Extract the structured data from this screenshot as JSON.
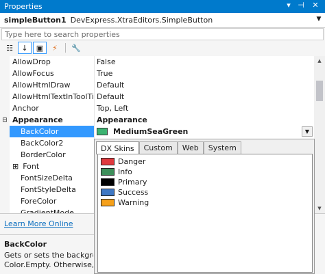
{
  "window": {
    "title": "Properties",
    "controls": [
      "▾",
      "⊣",
      "✕"
    ]
  },
  "object_selector": {
    "name": "simpleButton1",
    "type": "DevExpress.XtraEditors.SimpleButton"
  },
  "search": {
    "placeholder": "Type here to search properties"
  },
  "toolbar": {
    "buttons": [
      {
        "icon": "categorized-icon",
        "glyph": "☷",
        "active": false
      },
      {
        "icon": "alphabetical-icon",
        "glyph": "↓",
        "active": true
      },
      {
        "icon": "properties-icon",
        "glyph": "▣",
        "active": true
      },
      {
        "icon": "events-icon",
        "glyph": "⚡",
        "active": false
      },
      {
        "icon": "wrench-icon",
        "glyph": "🔧",
        "active": false
      }
    ]
  },
  "properties": [
    {
      "name": "AllowDrop",
      "value": "False"
    },
    {
      "name": "AllowFocus",
      "value": "True"
    },
    {
      "name": "AllowHtmlDraw",
      "value": "Default"
    },
    {
      "name": "AllowHtmlTextInToolTip",
      "value": "Default"
    },
    {
      "name": "Anchor",
      "value": "Top, Left"
    },
    {
      "name": "Appearance",
      "value": "Appearance",
      "expander": "⊟",
      "category": true
    },
    {
      "name": "BackColor",
      "value": "MediumSeaGreen",
      "indent": true,
      "selected": true
    },
    {
      "name": "BackColor2",
      "value": "",
      "indent": true
    },
    {
      "name": "BorderColor",
      "value": "",
      "indent": true
    },
    {
      "name": "Font",
      "value": "",
      "indent": true,
      "expander": "⊞"
    },
    {
      "name": "FontSizeDelta",
      "value": "",
      "indent": true
    },
    {
      "name": "FontStyleDelta",
      "value": "",
      "indent": true
    },
    {
      "name": "ForeColor",
      "value": "",
      "indent": true
    },
    {
      "name": "GradientMode",
      "value": "",
      "indent": true
    }
  ],
  "color_popup": {
    "tabs": [
      "DX Skins",
      "Custom",
      "Web",
      "System"
    ],
    "active_tab": 0,
    "colors": [
      {
        "label": "Danger",
        "color": "#e0393e"
      },
      {
        "label": "Info",
        "color": "#3d8f5a"
      },
      {
        "label": "Primary",
        "color": "#000000"
      },
      {
        "label": "Success",
        "color": "#3f78c4"
      },
      {
        "label": "Warning",
        "color": "#f5a01a"
      }
    ]
  },
  "selected_color": "#3cb371",
  "description": {
    "link": "Learn More Online",
    "title": "BackColor",
    "lines": [
      "Gets or sets the background",
      "Color.Empty. Otherwise, it s"
    ]
  }
}
